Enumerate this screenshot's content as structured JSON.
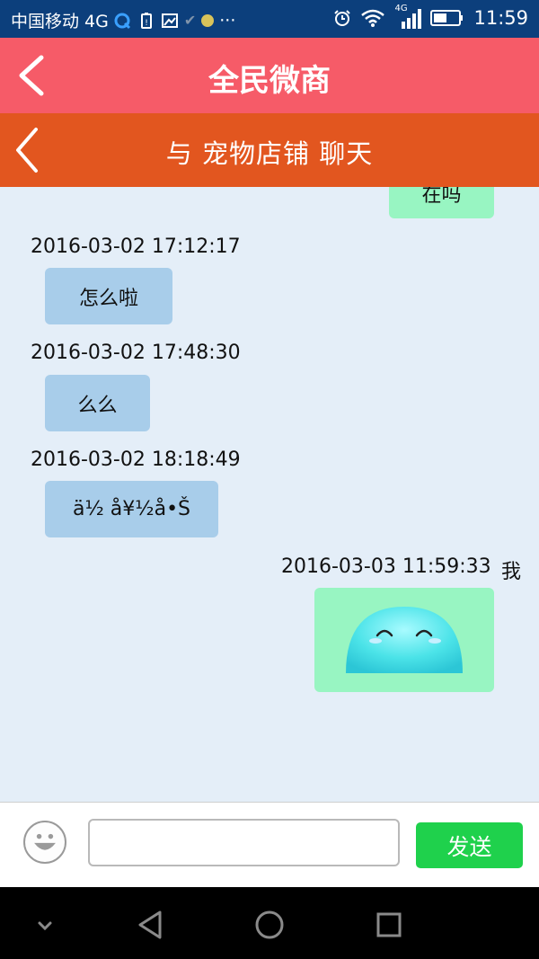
{
  "status_bar": {
    "carrier": "中国移动 4G",
    "network": "4G",
    "time": "11:59",
    "icons": [
      "q-icon",
      "battery-alert-icon",
      "image-icon",
      "check-icon",
      "dot-icon",
      "more-icon",
      "alarm-icon",
      "wifi-icon",
      "signal-icon",
      "battery-icon"
    ]
  },
  "app_header": {
    "title": "全民微商",
    "back_icon": "chevron-left-icon"
  },
  "chat_header": {
    "title": "与 宠物店铺 聊天",
    "back_icon": "chevron-left-icon"
  },
  "messages": [
    {
      "direction": "outgoing",
      "text": "在吗",
      "partial": true
    },
    {
      "direction": "incoming",
      "timestamp": "2016-03-02 17:12:17",
      "text": "怎么啦"
    },
    {
      "direction": "incoming",
      "timestamp": "2016-03-02 17:48:30",
      "text": "么么"
    },
    {
      "direction": "incoming",
      "timestamp": "2016-03-02 18:18:49",
      "text": "ä½ å¥½å•Š"
    },
    {
      "direction": "outgoing",
      "timestamp": "2016-03-03 11:59:33",
      "sender": "我",
      "content": "emoji-sticker"
    }
  ],
  "input_bar": {
    "emoji_icon": "smiley-icon",
    "input_value": "",
    "send_label": "发送"
  },
  "nav_bar": {
    "icons": [
      "chevron-down-icon",
      "back-triangle-icon",
      "home-circle-icon",
      "recents-square-icon"
    ]
  },
  "colors": {
    "status_bar": "#0c3f7c",
    "app_header": "#f65b68",
    "chat_header": "#e2561f",
    "chat_background": "#e4eef8",
    "incoming_bubble": "#a8cdea",
    "outgoing_bubble": "#98f5c2",
    "send_button": "#1fd14c"
  }
}
